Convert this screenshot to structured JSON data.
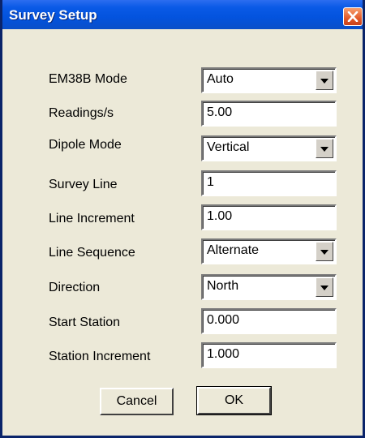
{
  "window": {
    "title": "Survey Setup"
  },
  "fields": [
    {
      "label": "EM38B Mode",
      "value": "Auto",
      "type": "select"
    },
    {
      "label": "Readings/s",
      "value": "5.00",
      "type": "input"
    },
    {
      "label": "Dipole Mode",
      "value": "Vertical",
      "type": "select"
    },
    {
      "label": "Survey Line",
      "value": "1",
      "type": "input"
    },
    {
      "label": "Line Increment",
      "value": "1.00",
      "type": "input"
    },
    {
      "label": "Line Sequence",
      "value": "Alternate",
      "type": "select"
    },
    {
      "label": "Direction",
      "value": "North",
      "type": "select"
    },
    {
      "label": "Start Station",
      "value": "0.000",
      "type": "input"
    },
    {
      "label": "Station Increment",
      "value": "1.000",
      "type": "input"
    }
  ],
  "buttons": {
    "cancel": "Cancel",
    "ok": "OK"
  },
  "icons": {
    "close": "close-icon",
    "dropdown": "chevron-down-icon"
  },
  "colors": {
    "titlebar": "#0353DE",
    "close_button": "#E35A2A",
    "dialog_background": "#ECE9D8"
  }
}
